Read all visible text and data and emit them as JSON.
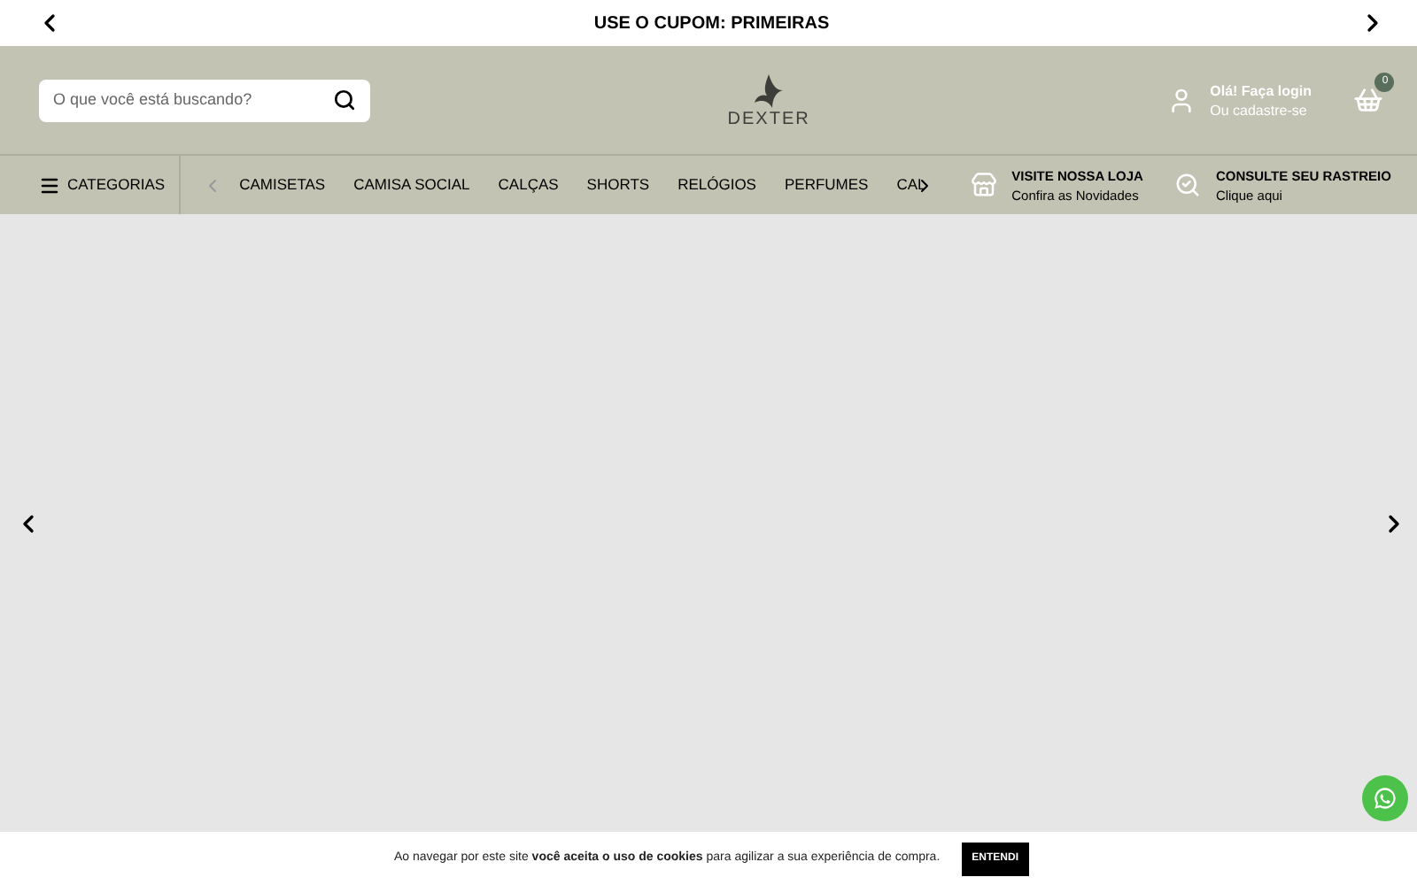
{
  "announcement": {
    "text": "USE O CUPOM: PRIMEIRAS"
  },
  "search": {
    "placeholder": "O que você está buscando?"
  },
  "logo": {
    "text": "DEXTER"
  },
  "account": {
    "title": "Olá! Faça login",
    "subtitle": "Ou cadastre-se"
  },
  "cart": {
    "count": "0"
  },
  "nav": {
    "categories_label": "CATEGORIAS",
    "items": [
      "CAMISETAS",
      "CAMISA SOCIAL",
      "CALÇAS",
      "SHORTS",
      "RELÓGIOS",
      "PERFUMES",
      "CAL"
    ]
  },
  "promos": [
    {
      "kind": "store",
      "title": "VISITE NOSSA LOJA",
      "subtitle": "Confira as Novidades"
    },
    {
      "kind": "tracking",
      "title": "CONSULTE SEU RASTREIO",
      "subtitle": "Clique aqui"
    }
  ],
  "cookie_bar": {
    "text": "Ao navegar por este site **você aceita o uso de cookies** para agilizar a sua experiência de compra.",
    "button": "ENTENDI"
  }
}
